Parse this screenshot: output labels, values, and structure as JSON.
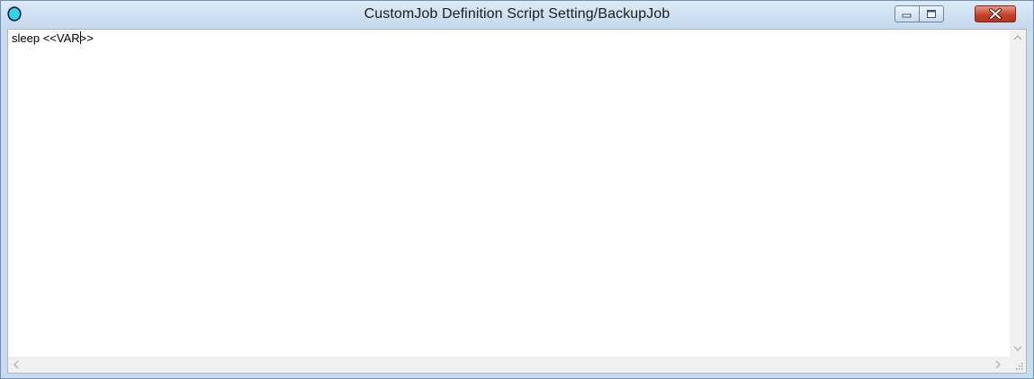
{
  "window": {
    "title": "CustomJob Definition Script Setting/BackupJob",
    "controls": {
      "minimize_icon": "minimize-icon",
      "maximize_icon": "maximize-icon",
      "close_icon": "close-icon"
    },
    "app_icon": "app-icon",
    "colors": {
      "titlebar": "#c4d9ef",
      "close_button": "#c4432d",
      "app_icon_fill": "#2fd6e6"
    }
  },
  "editor": {
    "line_before_caret": "sleep <<VAR",
    "line_after_caret": ">>"
  },
  "scrollbars": {
    "up_arrow": "chevron-up-icon",
    "down_arrow": "chevron-down-icon",
    "left_arrow": "chevron-left-icon",
    "right_arrow": "chevron-right-icon",
    "size_grip": "size-grip-icon"
  }
}
